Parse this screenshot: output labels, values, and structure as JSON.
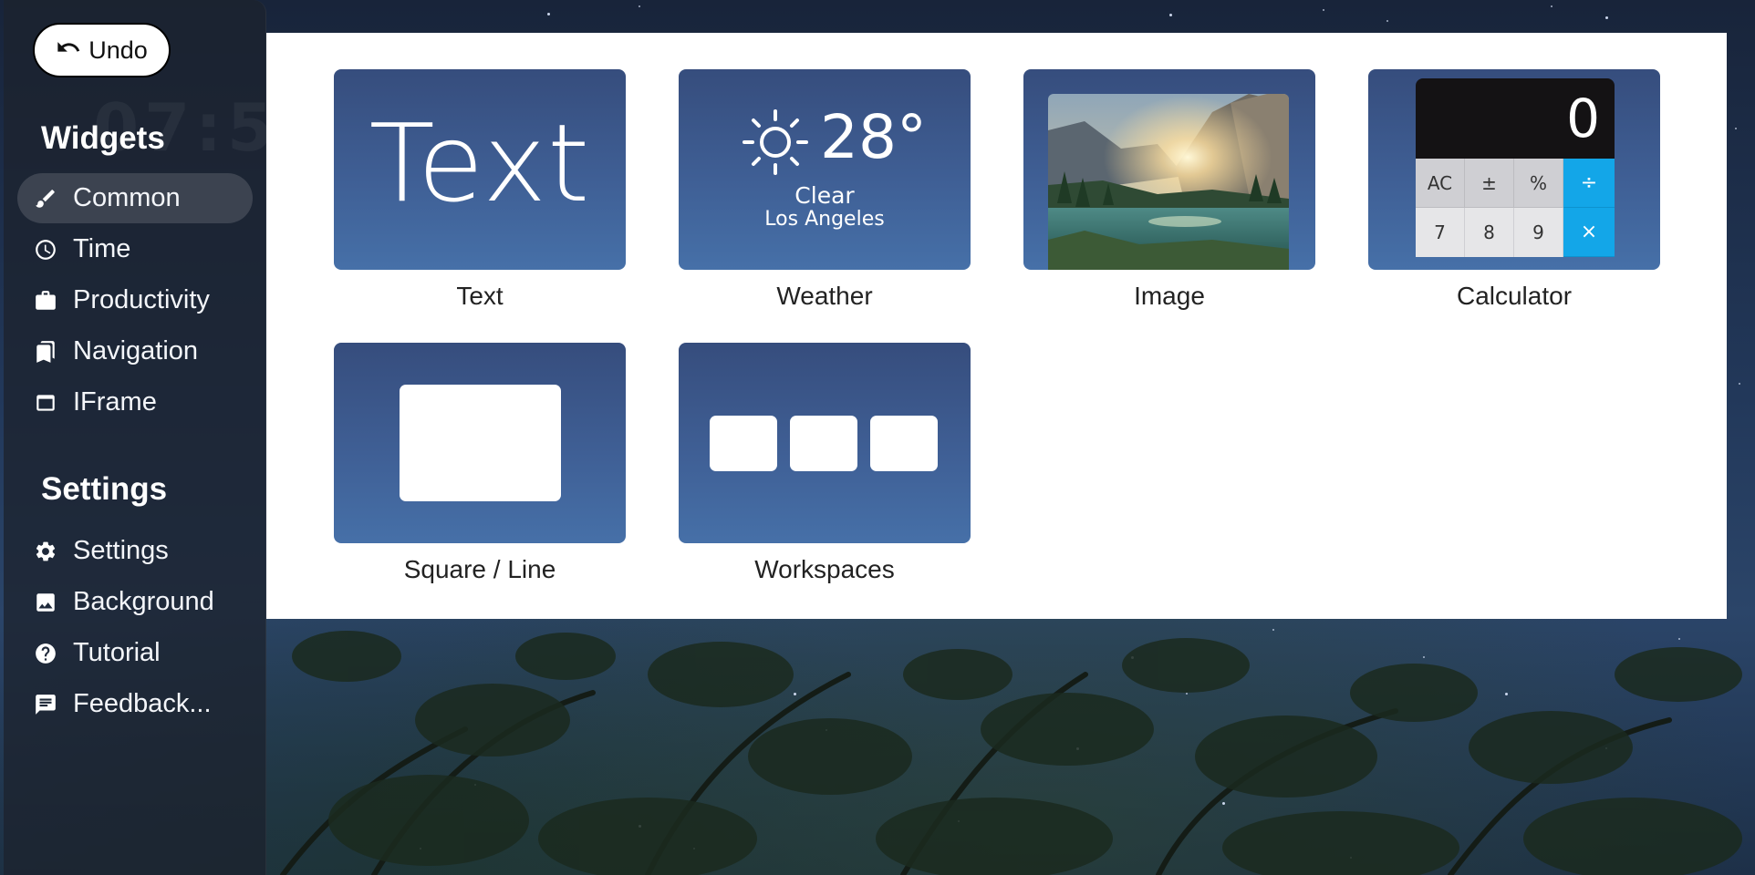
{
  "toolbar": {
    "undo_label": "Undo"
  },
  "sidebar": {
    "ghost_clock": "07:5",
    "widgets_title": "Widgets",
    "widget_items": [
      {
        "label": "Common",
        "icon": "brush-icon",
        "active": true
      },
      {
        "label": "Time",
        "icon": "clock-icon",
        "active": false
      },
      {
        "label": "Productivity",
        "icon": "briefcase-icon",
        "active": false
      },
      {
        "label": "Navigation",
        "icon": "bookmarks-icon",
        "active": false
      },
      {
        "label": "IFrame",
        "icon": "window-icon",
        "active": false
      }
    ],
    "settings_title": "Settings",
    "settings_items": [
      {
        "label": "Settings",
        "icon": "gear-icon"
      },
      {
        "label": "Background",
        "icon": "image-icon"
      },
      {
        "label": "Tutorial",
        "icon": "help-circle-icon"
      },
      {
        "label": "Feedback...",
        "icon": "comment-icon"
      }
    ]
  },
  "widgets": [
    {
      "label": "Text",
      "preview_text": "Text"
    },
    {
      "label": "Weather",
      "temperature": "28°",
      "condition": "Clear",
      "city": "Los Angeles"
    },
    {
      "label": "Image"
    },
    {
      "label": "Calculator",
      "display": "0",
      "keys_row1": [
        "AC",
        "±",
        "%",
        "÷"
      ],
      "keys_row2": [
        "7",
        "8",
        "9",
        "×"
      ]
    },
    {
      "label": "Square / Line"
    },
    {
      "label": "Workspaces"
    }
  ],
  "colors": {
    "thumb_top": "#364d7d",
    "thumb_bottom": "#4670a8",
    "calc_operator": "#13a6e8",
    "sidebar_bg": "rgba(28,34,46,0.78)"
  }
}
